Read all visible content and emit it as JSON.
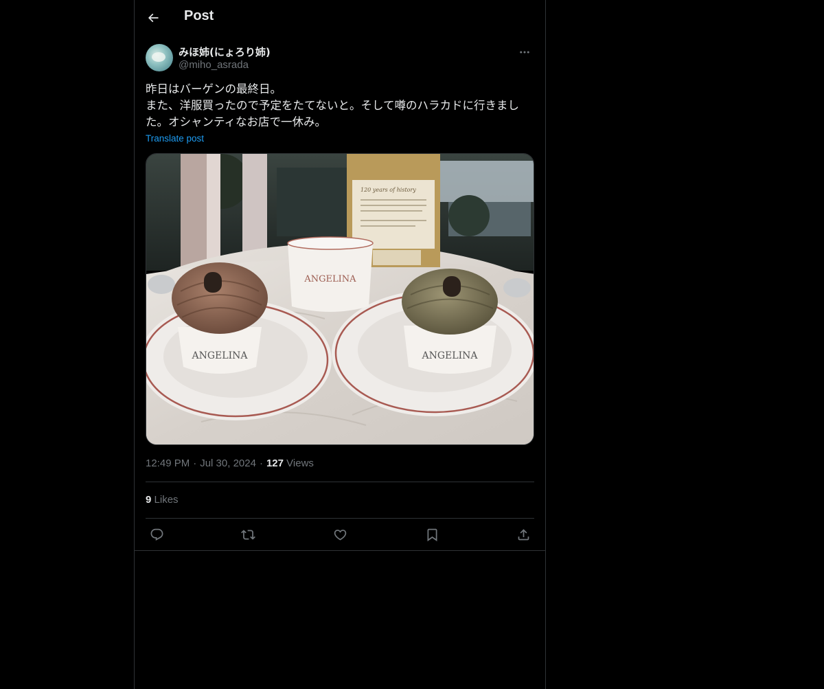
{
  "header": {
    "title": "Post",
    "back_icon": "arrow-left-icon"
  },
  "post": {
    "author": {
      "display_name": "みほ姉(にょろり姉)",
      "handle": "@miho_asrada"
    },
    "text": "昨日はバーゲンの最終日。\nまた、洋服買ったので予定をたてないと。そして噂のハラカドに行きました。オシャンティなお店で一休み。",
    "translate_label": "Translate post",
    "time": "12:49 PM",
    "date": "Jul 30, 2024",
    "separator": "·",
    "views_count": "127",
    "views_label": "Views",
    "likes_count": "9",
    "likes_label": "Likes",
    "media_signage": {
      "cup_label": "ANGELINA",
      "cup_label_right": "ANGELINA",
      "card_heading": "120 years of history"
    }
  },
  "actions": [
    {
      "name": "reply",
      "icon": "reply-icon"
    },
    {
      "name": "repost",
      "icon": "repost-icon"
    },
    {
      "name": "like",
      "icon": "heart-icon"
    },
    {
      "name": "bookmark",
      "icon": "bookmark-icon"
    },
    {
      "name": "share",
      "icon": "share-icon"
    }
  ],
  "colors": {
    "background": "#000000",
    "text_primary": "#e7e9ea",
    "text_secondary": "#71767b",
    "link": "#1d9bf0",
    "border": "#2f3336"
  }
}
